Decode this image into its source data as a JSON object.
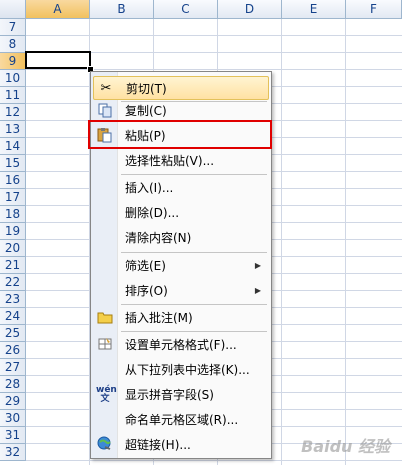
{
  "sheet": {
    "columns": [
      "A",
      "B",
      "C",
      "D",
      "E",
      "F"
    ],
    "rows": [
      "7",
      "8",
      "9",
      "10",
      "11",
      "12",
      "13",
      "14",
      "15",
      "16",
      "17",
      "18",
      "19",
      "20",
      "21",
      "22",
      "23",
      "24",
      "25",
      "26",
      "27",
      "28",
      "29",
      "30",
      "31",
      "32"
    ]
  },
  "context_menu": {
    "items": [
      {
        "label": "剪切(T)",
        "icon": "scissors-icon"
      },
      {
        "label": "复制(C)",
        "icon": "copy-icon"
      },
      {
        "label": "粘贴(P)",
        "icon": "paste-icon"
      },
      {
        "label": "选择性粘贴(V)..."
      },
      {
        "label": "插入(I)..."
      },
      {
        "label": "删除(D)..."
      },
      {
        "label": "清除内容(N)"
      },
      {
        "label": "筛选(E)"
      },
      {
        "label": "排序(O)"
      },
      {
        "label": "插入批注(M)",
        "icon": "comment-folder-icon"
      },
      {
        "label": "设置单元格格式(F)...",
        "icon": "format-cells-icon"
      },
      {
        "label": "从下拉列表中选择(K)..."
      },
      {
        "label": "显示拼音字段(S)",
        "icon": "phonetic-icon"
      },
      {
        "label": "命名单元格区域(R)..."
      },
      {
        "label": "超链接(H)...",
        "icon": "hyperlink-icon"
      }
    ]
  },
  "watermark": "Baidu 经验"
}
